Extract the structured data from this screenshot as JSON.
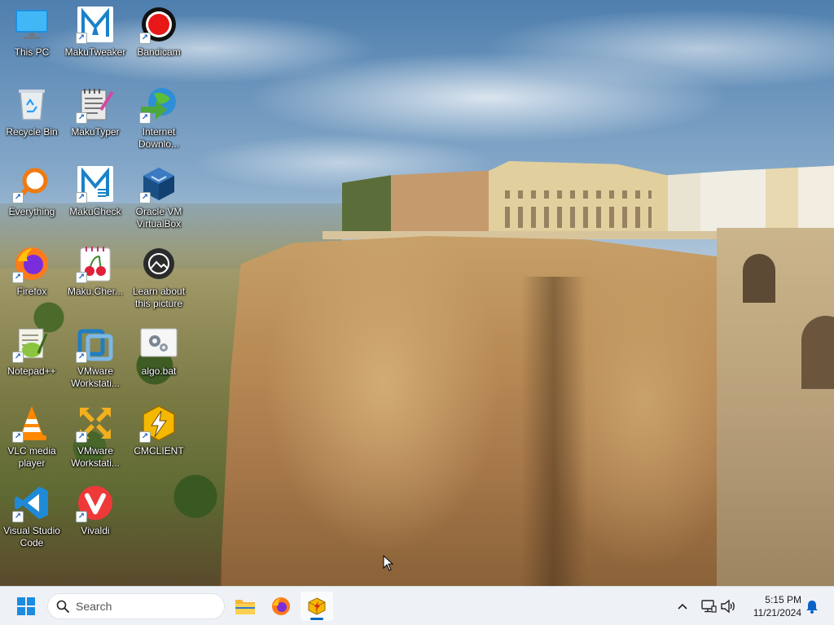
{
  "desktop": {
    "icons": [
      {
        "id": "this-pc",
        "label": "This PC",
        "icon": "monitor-icon"
      },
      {
        "id": "makutweaker",
        "label": "MakuTweaker",
        "icon": "makutweaker-icon"
      },
      {
        "id": "bandicam",
        "label": "Bandicam",
        "icon": "bandicam-record-icon"
      },
      {
        "id": "recycle-bin",
        "label": "Recycle Bin",
        "icon": "recycle-bin-icon"
      },
      {
        "id": "makutyper",
        "label": "MakuTyper",
        "icon": "notepad-pen-icon"
      },
      {
        "id": "internet-download",
        "label": "Internet Downlo...",
        "icon": "globe-download-icon"
      },
      {
        "id": "everything",
        "label": "Everything",
        "icon": "magnifier-icon"
      },
      {
        "id": "makucheck",
        "label": "MakuCheck",
        "icon": "makucheck-icon"
      },
      {
        "id": "virtualbox",
        "label": "Oracle VM VirtualBox",
        "icon": "virtualbox-cube-icon"
      },
      {
        "id": "firefox",
        "label": "Firefox",
        "icon": "firefox-icon"
      },
      {
        "id": "makucherry",
        "label": "Maku.Cher...",
        "icon": "cherry-icon"
      },
      {
        "id": "learn-picture",
        "label": "Learn about this picture",
        "icon": "learn-picture-icon"
      },
      {
        "id": "notepadpp",
        "label": "Notepad++",
        "icon": "notepadpp-icon"
      },
      {
        "id": "vmware1",
        "label": "VMware Workstati...",
        "icon": "vmware-icon"
      },
      {
        "id": "algo-bat",
        "label": "algo.bat",
        "icon": "gears-batch-icon"
      },
      {
        "id": "vlc",
        "label": "VLC media player",
        "icon": "vlc-cone-icon"
      },
      {
        "id": "vmware2",
        "label": "VMware Workstati...",
        "icon": "vmware-player-icon"
      },
      {
        "id": "cmclient",
        "label": "CMCLIENT",
        "icon": "lightning-hexagon-icon"
      },
      {
        "id": "vscode",
        "label": "Visual Studio Code",
        "icon": "vscode-icon"
      },
      {
        "id": "vivaldi",
        "label": "Vivaldi",
        "icon": "vivaldi-icon"
      }
    ]
  },
  "taskbar": {
    "start_icon": "windows-logo-icon",
    "search_placeholder": "Search",
    "pinned": [
      {
        "id": "file-explorer",
        "icon": "folder-icon",
        "active": false
      },
      {
        "id": "firefox",
        "icon": "firefox-icon",
        "active": false
      },
      {
        "id": "cmclient",
        "icon": "package-icon",
        "active": true
      }
    ],
    "tray": {
      "overflow_icon": "chevron-up-icon",
      "network_icon": "network-icon",
      "volume_icon": "speaker-icon",
      "notification_icon": "bell-icon"
    },
    "clock": {
      "time": "5:15 PM",
      "date": "11/21/2024"
    }
  },
  "colors": {
    "taskbar_bg": "#eef1f6",
    "accent": "#0067c0",
    "icon_label": "#ffffff"
  }
}
